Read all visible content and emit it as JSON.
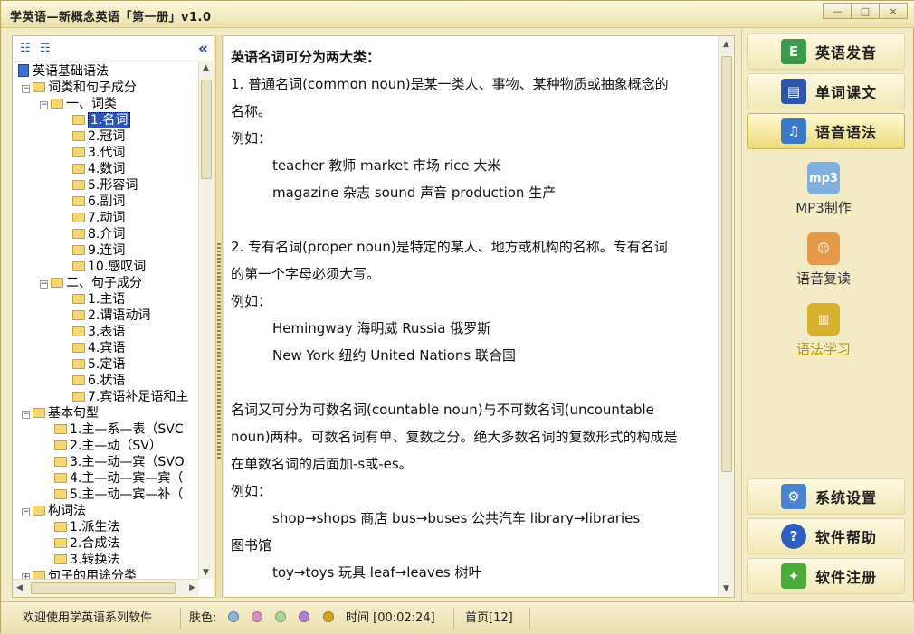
{
  "window": {
    "title": "学英语—新概念英语「第一册」v1.0",
    "min": "—",
    "max": "□",
    "close": "×"
  },
  "tree": {
    "nodes": [
      {
        "label": "英语基础语法"
      },
      {
        "label": "词类和句子成分"
      },
      {
        "label": "一、词类"
      },
      {
        "label": "1.名词"
      },
      {
        "label": "2.冠词"
      },
      {
        "label": "3.代词"
      },
      {
        "label": "4.数词"
      },
      {
        "label": "5.形容词"
      },
      {
        "label": "6.副词"
      },
      {
        "label": "7.动词"
      },
      {
        "label": "8.介词"
      },
      {
        "label": "9.连词"
      },
      {
        "label": "10.感叹词"
      },
      {
        "label": "二、句子成分"
      },
      {
        "label": "1.主语"
      },
      {
        "label": "2.谓语动词"
      },
      {
        "label": "3.表语"
      },
      {
        "label": "4.宾语"
      },
      {
        "label": "5.定语"
      },
      {
        "label": "6.状语"
      },
      {
        "label": "7.宾语补足语和主"
      },
      {
        "label": "基本句型"
      },
      {
        "label": "1.主—系—表（SVC"
      },
      {
        "label": "2.主—动（SV）"
      },
      {
        "label": "3.主—动—宾（SVO"
      },
      {
        "label": "4.主—动—宾—宾（"
      },
      {
        "label": "5.主—动—宾—补（"
      },
      {
        "label": "构词法"
      },
      {
        "label": "1.派生法"
      },
      {
        "label": "2.合成法"
      },
      {
        "label": "3.转换法"
      },
      {
        "label": "句子的用途分类"
      }
    ]
  },
  "content": {
    "heading": "英语名词可分为两大类：",
    "p1": "1. 普通名词(common noun)是某一类人、事物、某种物质或抽象概念的",
    "p1b": "名称。",
    "eg1": "例如：",
    "ex1a": "teacher 教师        market 市场          rice 大米",
    "ex1b": "magazine 杂志     sound 声音          production 生产",
    "p2": "2. 专有名词(proper noun)是特定的某人、地方或机构的名称。专有名词",
    "p2b": "的第一个字母必须大写。",
    "eg2": "例如：",
    "ex2a": "Hemingway 海明威          Russia 俄罗斯",
    "ex2b": "New York 纽约              United Nations 联合国",
    "p3": "名词又可分为可数名词(countable noun)与不可数名词(uncountable",
    "p3b": "noun)两种。可数名词有单、复数之分。绝大多数名词的复数形式的构成是",
    "p3c": "在单数名词的后面加-s或-es。",
    "eg3": "例如：",
    "ex3a": "shop→shops 商店  bus→buses 公共汽车       library→libraries",
    "ex3b": "图书馆",
    "ex3c": "toy→toys 玩具       leaf→leaves 树叶"
  },
  "nav": {
    "pronunciation": "英语发音",
    "vocab": "单词课文",
    "grammar": "语音语法",
    "mp3": "MP3制作",
    "repeat": "语音复读",
    "grammar_study": "语法学习",
    "settings": "系统设置",
    "help": "软件帮助",
    "register": "软件注册"
  },
  "status": {
    "welcome": "欢迎使用学英语系列软件",
    "skin_label": "肤色:",
    "skins": [
      "#8fb0d8",
      "#d88fc4",
      "#a8d88f",
      "#b27fd8",
      "#d8a020"
    ],
    "time": "时间 [00:02:24]",
    "page": "首页[12]"
  }
}
